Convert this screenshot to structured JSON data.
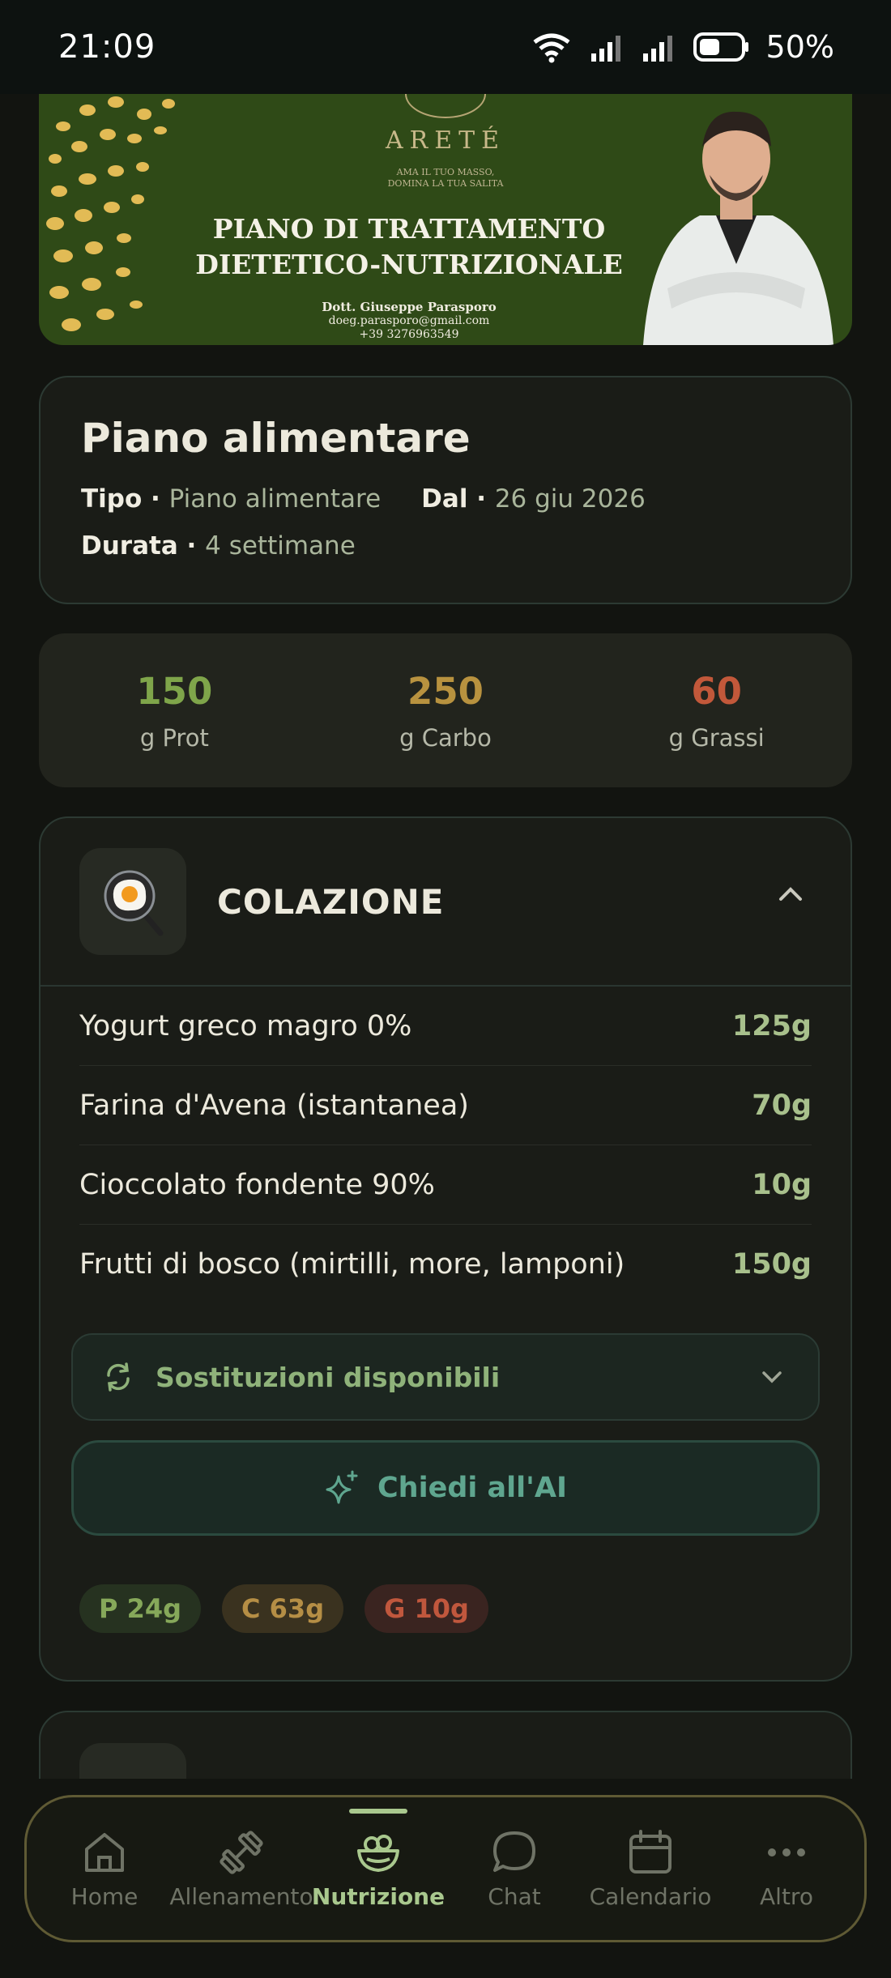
{
  "status_bar": {
    "time": "21:09",
    "battery": "50%"
  },
  "banner": {
    "brand": "ARETÉ",
    "tagline_1": "AMA IL TUO MASSO,",
    "tagline_2": "DOMINA LA TUA SALITA",
    "title_line1": "PIANO DI TRATTAMENTO",
    "title_line2": "DIETETICO-NUTRIZIONALE",
    "doctor": "Dott. Giuseppe Parasporo",
    "email": "doeg.parasporo@gmail.com",
    "phone": "+39 3276963549"
  },
  "plan": {
    "title": "Piano alimentare",
    "tipo_label": "Tipo",
    "tipo_value": "Piano alimentare",
    "dal_label": "Dal",
    "dal_value": "26 giu 2026",
    "durata_label": "Durata",
    "durata_value": "4 settimane"
  },
  "macros": [
    {
      "value": "150",
      "label": "g Prot",
      "color": "#7fa54a"
    },
    {
      "value": "250",
      "label": "g Carbo",
      "color": "#b8923f"
    },
    {
      "value": "60",
      "label": "g Grassi",
      "color": "#c2583a"
    }
  ],
  "meal": {
    "title": "COLAZIONE",
    "icon": "fried-egg-pan-icon",
    "foods": [
      {
        "name": "Yogurt greco magro 0%",
        "qty": "125g"
      },
      {
        "name": "Farina d'Avena (istantanea)",
        "qty": "70g"
      },
      {
        "name": "Cioccolato fondente 90%",
        "qty": "10g"
      },
      {
        "name": "Frutti di bosco (mirtilli, more, lamponi)",
        "qty": "150g"
      }
    ],
    "substitutions_label": "Sostituzioni disponibili",
    "ai_label": "Chiedi all'AI",
    "chips": [
      {
        "text": "P 24g",
        "color": "#86a85a",
        "bg": "#263220"
      },
      {
        "text": "C 63g",
        "color": "#b58e45",
        "bg": "#3a321f"
      },
      {
        "text": "G 10g",
        "color": "#c0573d",
        "bg": "#3a2420"
      }
    ]
  },
  "nav": {
    "items": [
      {
        "label": "Home",
        "icon": "home-icon"
      },
      {
        "label": "Allenamento",
        "icon": "dumbbell-icon"
      },
      {
        "label": "Nutrizione",
        "icon": "salad-bowl-icon",
        "active": true
      },
      {
        "label": "Chat",
        "icon": "chat-bubble-icon"
      },
      {
        "label": "Calendario",
        "icon": "calendar-icon"
      },
      {
        "label": "Altro",
        "icon": "more-dots-icon"
      }
    ]
  }
}
